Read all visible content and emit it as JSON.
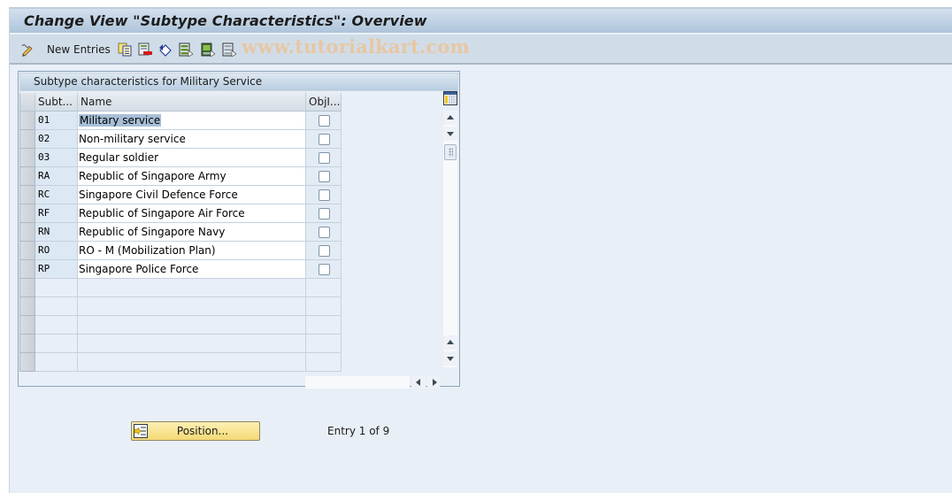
{
  "window": {
    "title": "Change View \"Subtype Characteristics\": Overview"
  },
  "toolbar": {
    "new_entries_label": "New Entries",
    "icons": [
      "display-change-icon",
      "copy-icon",
      "delete-icon",
      "undo-icon",
      "select-all-icon",
      "select-block-icon",
      "deselect-all-icon"
    ],
    "watermark": "www.tutorialkart.com"
  },
  "table": {
    "title": "Subtype characteristics for Military Service",
    "columns": [
      "Subt...",
      "Name",
      "ObjI..."
    ],
    "rows": [
      {
        "code": "01",
        "name": "Military service",
        "objid": false,
        "selected": true
      },
      {
        "code": "02",
        "name": "Non-military service",
        "objid": false
      },
      {
        "code": "03",
        "name": "Regular soldier",
        "objid": false
      },
      {
        "code": "RA",
        "name": "Republic of Singapore Army",
        "objid": false
      },
      {
        "code": "RC",
        "name": "Singapore Civil Defence Force",
        "objid": false
      },
      {
        "code": "RF",
        "name": "Republic of Singapore Air Force",
        "objid": false
      },
      {
        "code": "RN",
        "name": "Republic of Singapore Navy",
        "objid": false
      },
      {
        "code": "RO",
        "name": "RO - M (Mobilization Plan)",
        "objid": false
      },
      {
        "code": "RP",
        "name": "Singapore Police Force",
        "objid": false
      }
    ],
    "empty_rows": 5
  },
  "footer": {
    "position_button_label": "Position...",
    "entry_info": "Entry 1 of 9"
  },
  "colors": {
    "title_bar": "#aec4db",
    "toolbar_bg": "#d0dde8",
    "page_bg": "#e9eff7",
    "position_button": "#f4d976",
    "selection_highlight": "#a8bfd8"
  }
}
